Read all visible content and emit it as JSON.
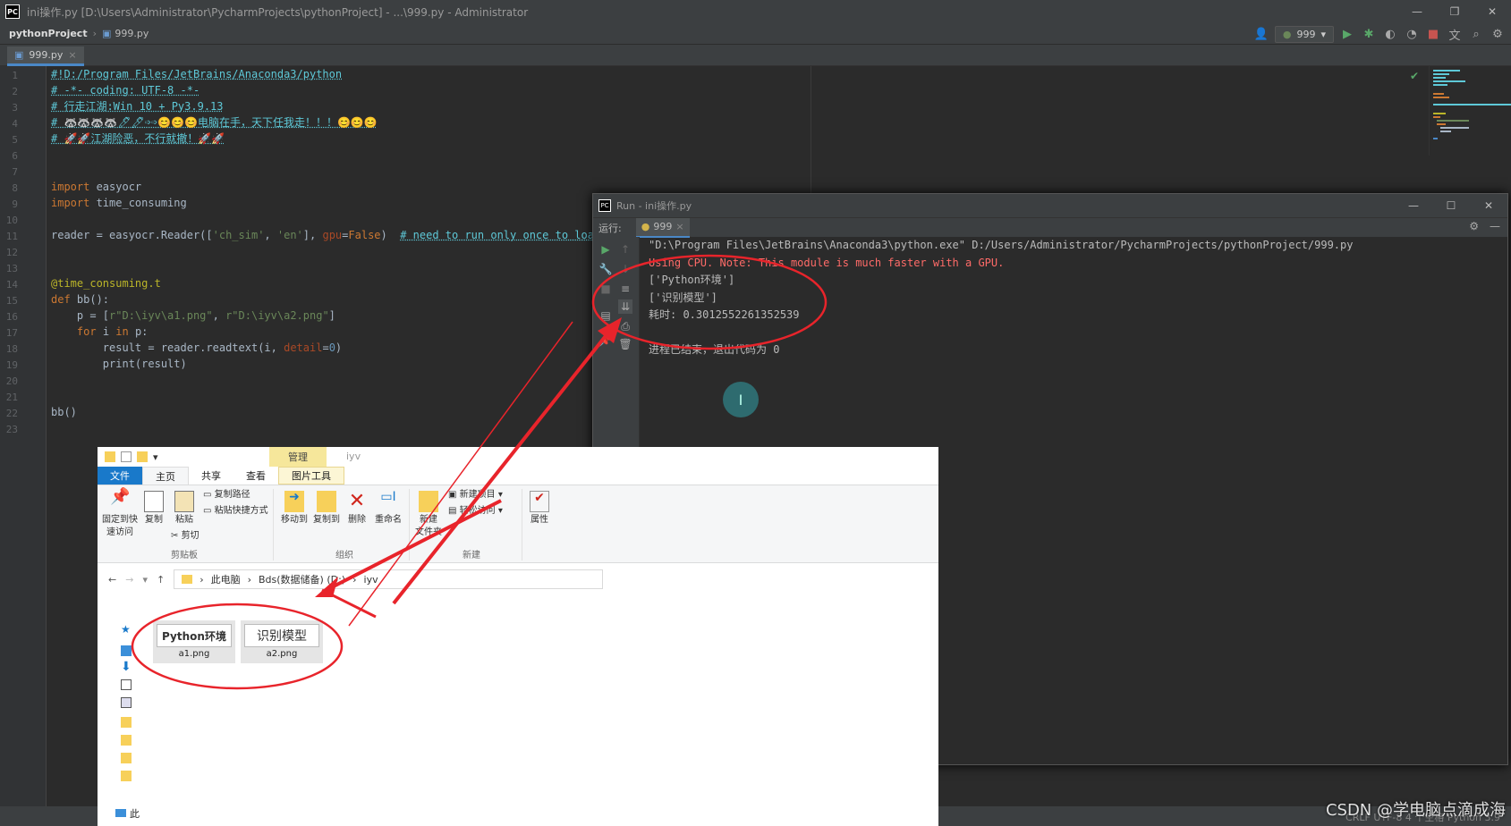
{
  "ide": {
    "title": "ini操作.py [D:\\Users\\Administrator\\PycharmProjects\\pythonProject] - ...\\999.py - Administrator",
    "breadcrumb_project": "pythonProject",
    "breadcrumb_file": "999.py",
    "run_config": "999",
    "tab_label": "999.py",
    "status_right": "CRLF   UTF-8   4 个空格   Python 3.9"
  },
  "editor": {
    "line_numbers": [
      "1",
      "2",
      "3",
      "4",
      "5",
      "6",
      "7",
      "8",
      "9",
      "10",
      "11",
      "12",
      "13",
      "14",
      "15",
      "16",
      "17",
      "18",
      "19",
      "20",
      "21",
      "22",
      "23"
    ],
    "lines": [
      "#!D:/Program Files/JetBrains/Anaconda3/python",
      "# -*- coding: UTF-8 -*-",
      "# 行走江湖:Win 10 + Py3.9.13",
      "# 🦝🦝🦝🦝🖊🖊➩➩😊😊😊电脑在手，天下任我走！！！😊😊😊",
      "# 🚀🚀江湖险恶，不行就撤！🚀🚀",
      "",
      "",
      "import easyocr",
      "import time_consuming",
      "",
      "reader = easyocr.Reader(['ch_sim', 'en'], gpu=False)  # need to run only once to load",
      "",
      "",
      "@time_consuming.t",
      "def bb():",
      "    p = [r\"D:\\iyv\\a1.png\", r\"D:\\iyv\\a2.png\"]",
      "    for i in p:",
      "        result = reader.readtext(i, detail=0)",
      "        print(result)",
      "",
      "",
      "bb()",
      ""
    ]
  },
  "run_window": {
    "title": "Run - ini操作.py",
    "tab_prefix": "运行:",
    "tab_label": "999",
    "console": [
      {
        "text": "\"D:\\Program Files\\JetBrains\\Anaconda3\\python.exe\" D:/Users/Administrator/PycharmProjects/pythonProject/999.py",
        "kind": "normal"
      },
      {
        "text": "Using CPU. Note: This module is much faster with a GPU.",
        "kind": "error"
      },
      {
        "text": "['Python环境']",
        "kind": "normal"
      },
      {
        "text": "['识别模型']",
        "kind": "normal"
      },
      {
        "text": "耗时: 0.3012552261352539",
        "kind": "normal"
      },
      {
        "text": "",
        "kind": "normal"
      },
      {
        "text": "进程已结束，退出代码为 0",
        "kind": "normal"
      }
    ]
  },
  "explorer": {
    "folder_title": "iyv",
    "manage_tab": "管理",
    "tabs": [
      "文件",
      "主页",
      "共享",
      "查看",
      "图片工具"
    ],
    "ribbon": {
      "pin": "固定到快\n速访问",
      "copy": "复制",
      "paste": "粘贴",
      "copy_path": "复制路径",
      "paste_shortcut": "粘贴快捷方式",
      "cut": "剪切",
      "group_clipboard": "剪贴板",
      "move_to": "移动到",
      "copy_to": "复制到",
      "delete": "删除",
      "rename": "重命名",
      "group_organize": "组织",
      "new_folder": "新建\n文件夹",
      "new_item": "新建项目",
      "easy_access": "轻松访问",
      "group_new": "新建",
      "properties": "属性"
    },
    "path": [
      "此电脑",
      "Bds(数据储备) (D:)",
      "iyv"
    ],
    "files": [
      {
        "thumb_text": "Python环境",
        "name": "a1.png"
      },
      {
        "thumb_text": "识别模型",
        "name": "a2.png"
      }
    ],
    "nav_bottom": "此"
  },
  "watermark": "CSDN @学电脑点滴成海",
  "colors": {
    "annotation_red": "#e8242b",
    "accent_blue": "#4a88c7"
  }
}
